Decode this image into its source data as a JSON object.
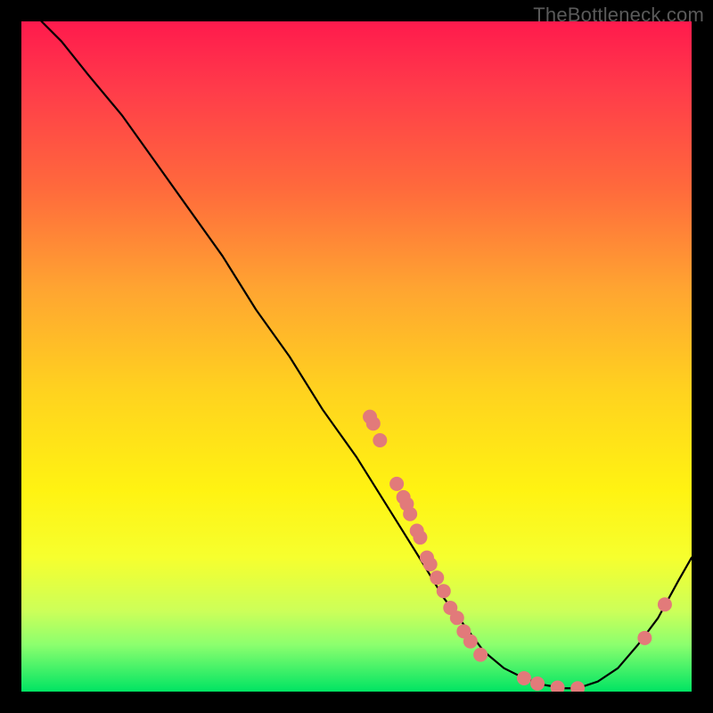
{
  "watermark": "TheBottleneck.com",
  "colors": {
    "marker": "#e27a7a",
    "curve": "#000000"
  },
  "chart_data": {
    "type": "line",
    "title": "",
    "xlabel": "",
    "ylabel": "",
    "xlim": [
      0,
      100
    ],
    "ylim": [
      0,
      100
    ],
    "curve": {
      "x": [
        3,
        6,
        10,
        15,
        20,
        25,
        30,
        35,
        40,
        45,
        50,
        55,
        60,
        63,
        66,
        69,
        72,
        75,
        78,
        81,
        83,
        86,
        89,
        92,
        95,
        98,
        100
      ],
      "y": [
        100,
        97,
        92,
        86,
        79,
        72,
        65,
        57,
        50,
        42,
        35,
        27,
        19,
        14,
        10,
        6,
        3.5,
        2,
        1,
        0.5,
        0.5,
        1.5,
        3.5,
        7,
        11,
        16.5,
        20
      ]
    },
    "markers": [
      {
        "x": 52,
        "y": 41
      },
      {
        "x": 52.5,
        "y": 40
      },
      {
        "x": 53.5,
        "y": 37.5
      },
      {
        "x": 56,
        "y": 31
      },
      {
        "x": 57,
        "y": 29
      },
      {
        "x": 57.5,
        "y": 28
      },
      {
        "x": 58,
        "y": 26.5
      },
      {
        "x": 59,
        "y": 24
      },
      {
        "x": 59.5,
        "y": 23
      },
      {
        "x": 60.5,
        "y": 20
      },
      {
        "x": 61,
        "y": 19
      },
      {
        "x": 62,
        "y": 17
      },
      {
        "x": 63,
        "y": 15
      },
      {
        "x": 64,
        "y": 12.5
      },
      {
        "x": 65,
        "y": 11
      },
      {
        "x": 66,
        "y": 9
      },
      {
        "x": 67,
        "y": 7.5
      },
      {
        "x": 68.5,
        "y": 5.5
      },
      {
        "x": 75,
        "y": 2
      },
      {
        "x": 77,
        "y": 1.2
      },
      {
        "x": 80,
        "y": 0.6
      },
      {
        "x": 83,
        "y": 0.5
      },
      {
        "x": 93,
        "y": 8
      },
      {
        "x": 96,
        "y": 13
      }
    ]
  }
}
